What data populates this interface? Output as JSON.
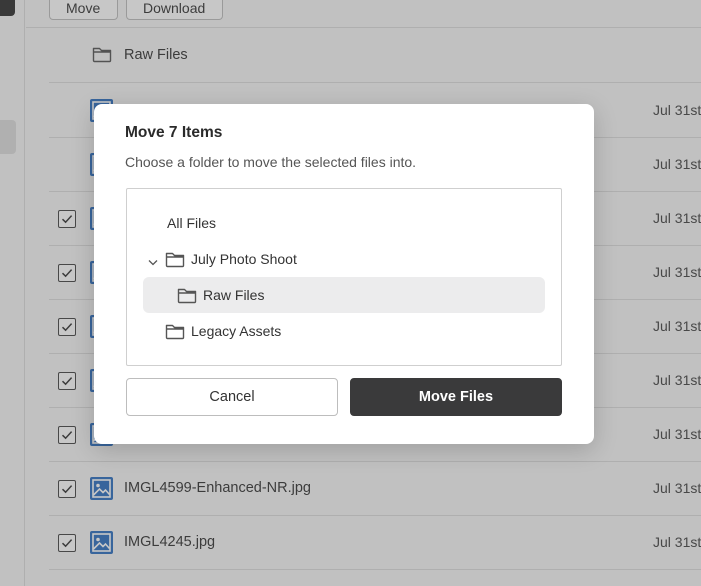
{
  "toolbar": {
    "move_label": "Move",
    "download_label": "Download"
  },
  "file_list": {
    "folder_row": {
      "name": "Raw Files",
      "icon": "folder-icon"
    },
    "rows": [
      {
        "name": "",
        "date": "Jul 31st",
        "checked": false
      },
      {
        "name": "",
        "date": "Jul 31st",
        "checked": false
      },
      {
        "name": "",
        "date": "Jul 31st",
        "checked": true
      },
      {
        "name": "",
        "date": "Jul 31st",
        "checked": true
      },
      {
        "name": "",
        "date": "Jul 31st",
        "checked": true
      },
      {
        "name": "",
        "date": "Jul 31st",
        "checked": true
      },
      {
        "name": "",
        "date": "Jul 31st",
        "checked": true
      },
      {
        "name": "IMGL4599-Enhanced-NR.jpg",
        "date": "Jul 31st",
        "checked": true
      },
      {
        "name": "IMGL4245.jpg",
        "date": "Jul 31st",
        "checked": true
      }
    ]
  },
  "dialog": {
    "title": "Move 7 Items",
    "subtitle": "Choose a folder to move the selected files into.",
    "tree": [
      {
        "label": "All Files",
        "icon": "",
        "expanded": null,
        "selected": false
      },
      {
        "label": "July Photo Shoot",
        "icon": "folder-icon",
        "expanded": true,
        "selected": false
      },
      {
        "label": "Raw Files",
        "icon": "folder-icon",
        "expanded": null,
        "selected": true
      },
      {
        "label": "Legacy Assets",
        "icon": "folder-icon",
        "expanded": null,
        "selected": false
      }
    ],
    "cancel_label": "Cancel",
    "confirm_label": "Move Files"
  },
  "colors": {
    "accent_dark": "#3a3a3b",
    "image_icon": "#2d6fc0",
    "selected_row": "#ececed"
  }
}
